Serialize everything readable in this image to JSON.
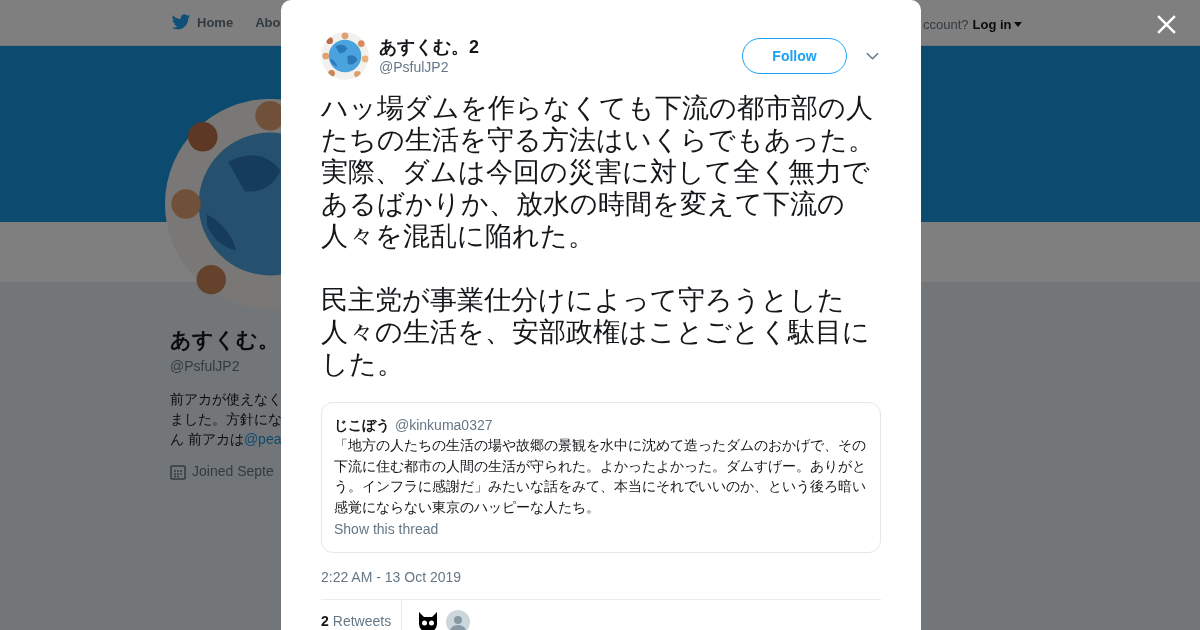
{
  "background_page": {
    "nav": {
      "home": "Home",
      "about": "Abo",
      "account_prompt": "ccount?",
      "login": "Log in"
    },
    "profile": {
      "name": "あすくむ。",
      "handle": "@PsfulJP2",
      "bio_lines": [
        "前アカが使えなく",
        "ました。方針にな",
        "ん 前アカは"
      ],
      "bio_link": "@pea",
      "joined": "Joined Septe"
    }
  },
  "tweet": {
    "author": {
      "name": "あすくむ。2",
      "handle": "@PsfulJP2"
    },
    "follow_button": "Follow",
    "paragraphs": [
      "ハッ場ダムを作らなくても下流の都市部の人たちの生活を守る方法はいくらでもあった。実際、ダムは今回の災害に対して全く無力であるばかりか、放水の時間を変えて下流の人々を混乱に陥れた。",
      "民主党が事業仕分けによって守ろうとした人々の生活を、安部政権はことごとく駄目にした。"
    ],
    "quote": {
      "name": "じこぼう",
      "handle": "@kinkuma0327",
      "text": "「地方の人たちの生活の場や故郷の景観を水中に沈めて造ったダムのおかげで、その下流に住む都市の人間の生活が守られた。よかったよかった。ダムすげー。ありがとう。インフラに感謝だ」みたいな話をみて、本当にそれでいいのか、という後ろ暗い感覚にならない東京のハッピーな人たち。",
      "show_thread": "Show this thread"
    },
    "timestamp": "2:22 AM - 13 Oct 2019",
    "retweets": {
      "count": "2",
      "label": "Retweets"
    },
    "retweeters": [
      {
        "kind": "cat"
      },
      {
        "kind": "default"
      }
    ]
  }
}
